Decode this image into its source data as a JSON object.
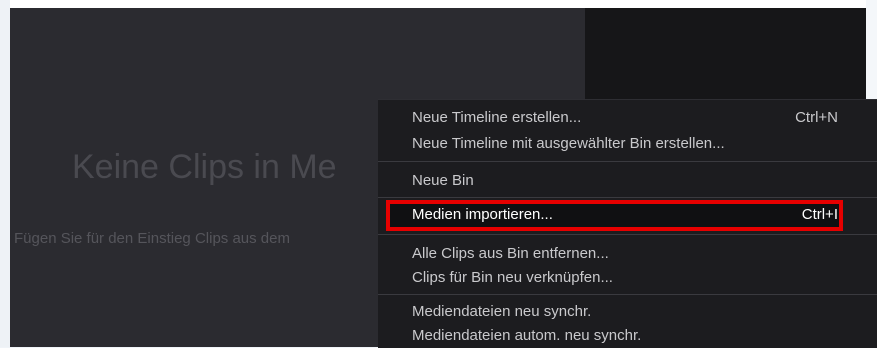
{
  "media_pool": {
    "empty_title": "Keine Clips in Me",
    "empty_hint": "Fügen Sie für den Einstieg Clips aus dem"
  },
  "context_menu": {
    "items": [
      {
        "label": "Neue Timeline erstellen...",
        "shortcut": "Ctrl+N"
      },
      {
        "label": "Neue Timeline mit ausgewählter Bin erstellen...",
        "shortcut": ""
      },
      {
        "label": "Neue Bin",
        "shortcut": ""
      },
      {
        "label": "Medien importieren...",
        "shortcut": "Ctrl+I",
        "highlighted": true
      },
      {
        "label": "Alle Clips aus Bin entfernen...",
        "shortcut": ""
      },
      {
        "label": "Clips für Bin neu verknüpfen...",
        "shortcut": ""
      },
      {
        "label": "Mediendateien neu synchr.",
        "shortcut": ""
      },
      {
        "label": "Mediendateien autom. neu synchr.",
        "shortcut": ""
      }
    ]
  },
  "colors": {
    "highlight_border": "#e60000",
    "menu_background": "#1c1c1f",
    "media_pool_background": "#2b2b30"
  }
}
